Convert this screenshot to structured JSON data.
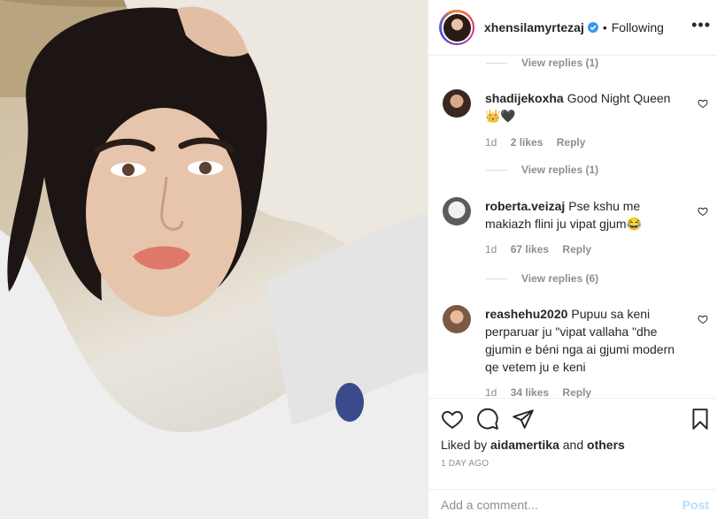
{
  "post": {
    "username": "xhensilamyrtezaj",
    "follow_state": "Following",
    "more_label": "•••"
  },
  "comments": {
    "view_replies_top": "View replies (1)",
    "items": [
      {
        "username": "shadijekoxha",
        "text": "Good Night Queen 👑🖤",
        "age": "1d",
        "likes": "2 likes",
        "reply": "Reply",
        "view_replies": "View replies (1)"
      },
      {
        "username": "roberta.veizaj",
        "text": "Pse kshu me makiazh flini ju vipat gjum😂",
        "age": "1d",
        "likes": "67 likes",
        "reply": "Reply",
        "view_replies": "View replies (6)"
      },
      {
        "username": "reashehu2020",
        "text": "Pupuu sa keni perparuar ju \"vipat vallaha \"dhe gjumin e béni nga ai gjumi modern qe vetem ju e keni ⁣⁣⁣⁣",
        "age": "1d",
        "likes": "34 likes",
        "reply": "Reply"
      }
    ]
  },
  "actions": {
    "liked_by_prefix": "Liked by ",
    "liked_by_user": "aidamertika",
    "liked_by_and": " and ",
    "liked_by_others": "others",
    "time_ago": "1 DAY AGO"
  },
  "composer": {
    "placeholder": "Add a comment...",
    "post_label": "Post"
  },
  "colors": {
    "annotation": "#e2262b",
    "verified": "#3897f0",
    "post_disabled": "#b2dffc"
  }
}
